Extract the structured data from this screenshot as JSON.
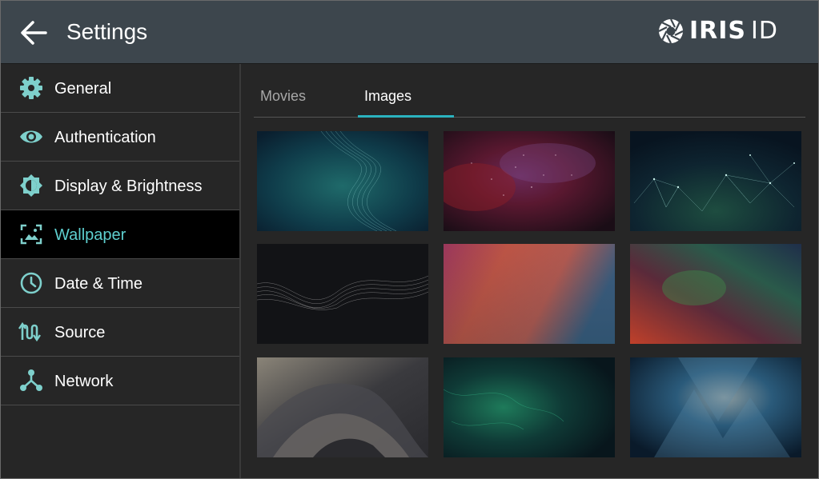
{
  "header": {
    "title": "Settings",
    "back_icon": "arrow-left-icon",
    "brand": {
      "name": "IRIS",
      "suffix": "ID",
      "logo_icon": "aperture-logo-icon"
    }
  },
  "sidebar": {
    "items": [
      {
        "label": "General",
        "icon": "gear-icon",
        "active": false
      },
      {
        "label": "Authentication",
        "icon": "eye-icon",
        "active": false
      },
      {
        "label": "Display & Brightness",
        "icon": "brightness-icon",
        "active": false
      },
      {
        "label": "Wallpaper",
        "icon": "wallpaper-icon",
        "active": true
      },
      {
        "label": "Date & Time",
        "icon": "clock-icon",
        "active": false
      },
      {
        "label": "Source",
        "icon": "source-icon",
        "active": false
      },
      {
        "label": "Network",
        "icon": "network-icon",
        "active": false
      }
    ]
  },
  "tabs": [
    {
      "label": "Movies",
      "selected": false
    },
    {
      "label": "Images",
      "selected": true
    }
  ],
  "colors": {
    "accent": "#2bb3bf",
    "active_text": "#5ecfcf",
    "header_bg": "#3d464d",
    "panel_bg": "#262626",
    "icon": "#7ed0cc"
  }
}
